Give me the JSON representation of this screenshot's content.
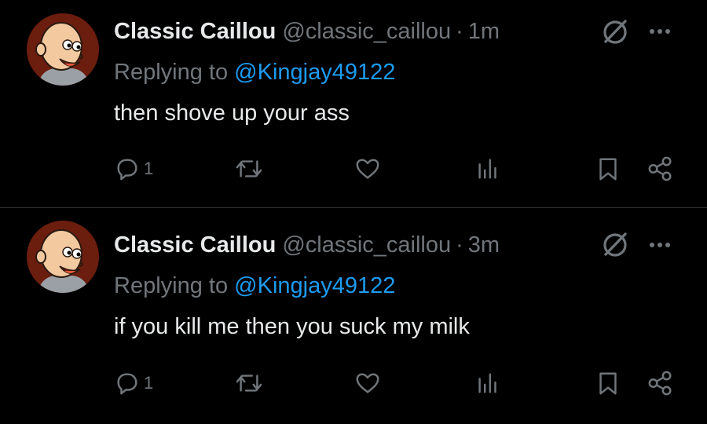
{
  "tweets": [
    {
      "name": "Classic Caillou",
      "handle": "@classic_caillou",
      "separator": "·",
      "time": "1m",
      "replying_prefix": "Replying to ",
      "replying_to": "@Kingjay49122",
      "text": "then shove up your ass",
      "reply_count": "1",
      "icons": [
        "grok-icon",
        "more-icon",
        "reply-icon",
        "retweet-icon",
        "like-icon",
        "views-icon",
        "bookmark-icon",
        "share-icon"
      ]
    },
    {
      "name": "Classic Caillou",
      "handle": "@classic_caillou",
      "separator": "·",
      "time": "3m",
      "replying_prefix": "Replying to ",
      "replying_to": "@Kingjay49122",
      "text": "if you kill me then you suck my milk",
      "reply_count": "1",
      "icons": [
        "grok-icon",
        "more-icon",
        "reply-icon",
        "retweet-icon",
        "like-icon",
        "views-icon",
        "bookmark-icon",
        "share-icon"
      ]
    }
  ],
  "colors": {
    "background": "#000000",
    "text": "#e7e9ea",
    "muted": "#71767b",
    "mention": "#1d9bf0",
    "divider": "#2f3336"
  }
}
